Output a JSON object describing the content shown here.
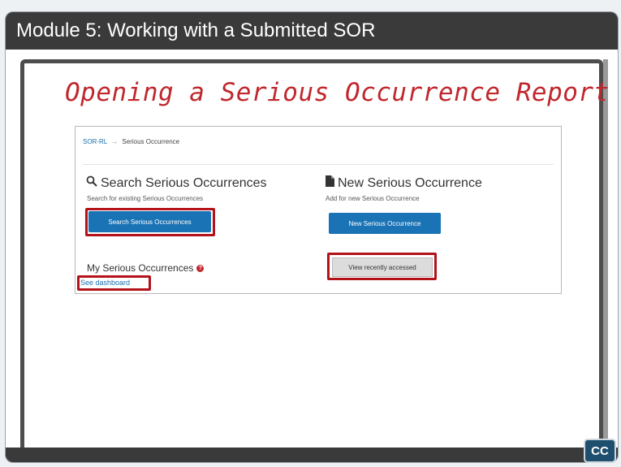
{
  "slide": {
    "title": "Module 5:  Working with a Submitted SOR",
    "heading": "Opening a Serious Occurrence Report",
    "cc_label": "CC"
  },
  "app": {
    "breadcrumb": {
      "root": "SOR-RL",
      "separator": "→",
      "current": "Serious Occurrence"
    },
    "search_section": {
      "title": "Search Serious Occurrences",
      "subtitle": "Search for existing Serious Occurrences",
      "button_label": "Search Serious Occurrences",
      "icon": "search-icon"
    },
    "new_section": {
      "title": "New Serious Occurrence",
      "subtitle": "Add for new Serious Occurrence",
      "button_label": "New Serious Occurrence",
      "icon": "document-icon"
    },
    "my_section": {
      "title": "My Serious Occurrences",
      "help_glyph": "?",
      "link_label": "See dashboard"
    },
    "recent_button_label": "View recently accessed"
  },
  "colors": {
    "highlight": "#b3121a",
    "primary_button": "#1a73b5",
    "heading": "#c0272d",
    "title_bar": "#3a3a3a"
  }
}
